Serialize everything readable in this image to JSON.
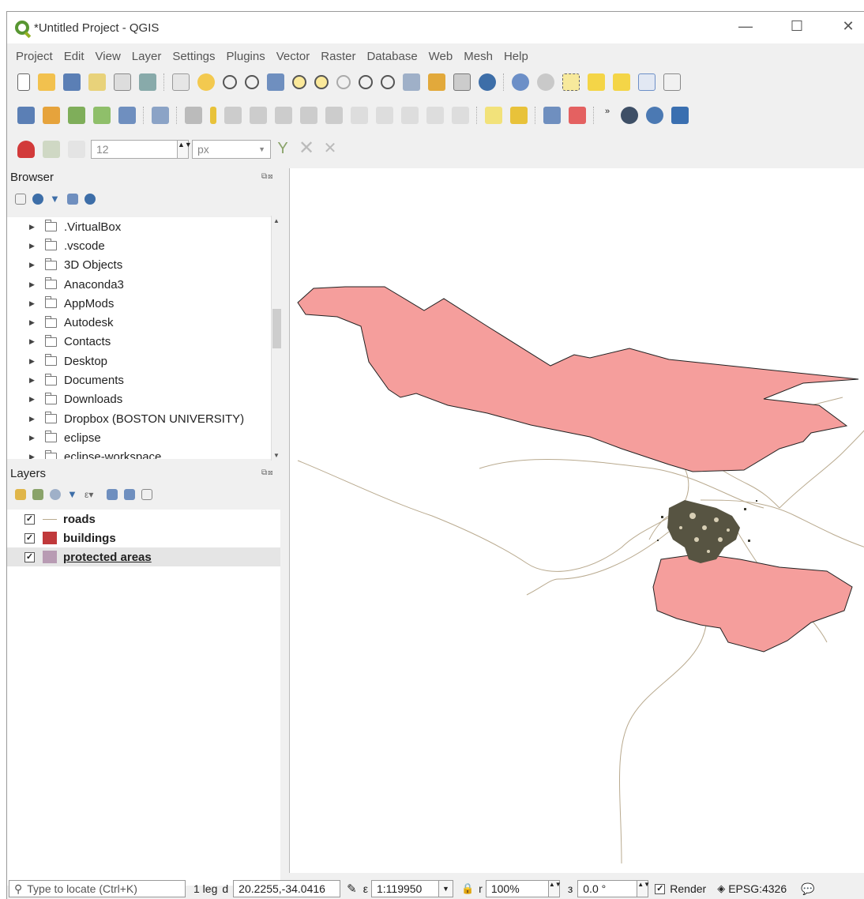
{
  "window": {
    "title": "*Untitled Project - QGIS"
  },
  "window_controls": {
    "minimize": "—",
    "maximize": "☐",
    "close": "✕"
  },
  "menu": [
    "Project",
    "Edit",
    "View",
    "Layer",
    "Settings",
    "Plugins",
    "Vector",
    "Raster",
    "Database",
    "Web",
    "Mesh",
    "Help"
  ],
  "snapping": {
    "tolerance_value": "12",
    "units": "px"
  },
  "browser": {
    "title": "Browser",
    "items": [
      ".VirtualBox",
      ".vscode",
      "3D Objects",
      "Anaconda3",
      "AppMods",
      "Autodesk",
      "Contacts",
      "Desktop",
      "Documents",
      "Downloads",
      "Dropbox (BOSTON UNIVERSITY)",
      "eclipse",
      "eclipse-workspace"
    ]
  },
  "layers": {
    "title": "Layers",
    "items": [
      {
        "name": "roads",
        "checked": "✓",
        "color": "#b9aa8f"
      },
      {
        "name": "buildings",
        "checked": "✓",
        "color": "#c0393b"
      },
      {
        "name": "protected areas",
        "checked": "✓",
        "color": "#b89bb3"
      }
    ]
  },
  "map": {
    "fill_color": "#f59e9c",
    "road_color": "#b9aa8f",
    "building_color": "#3a3a30"
  },
  "statusbar": {
    "locate_placeholder": "Type to locate (Ctrl+K)",
    "legend_label": "1 leg",
    "coord_label": "d",
    "coordinate": "20.2255,-34.0416",
    "scale_label": "ε",
    "scale": "1:119950",
    "magnifier_label": "r",
    "magnifier": "100%",
    "rotation_label": "з",
    "rotation": "0.0 °",
    "render_label": "Render",
    "render_checked": "✓",
    "crs": "EPSG:4326"
  }
}
